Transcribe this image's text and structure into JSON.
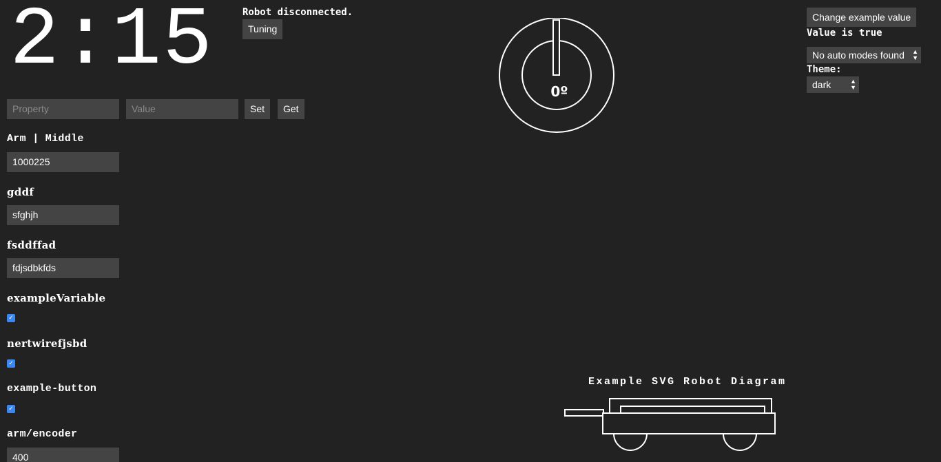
{
  "timer": {
    "value": "2:15"
  },
  "status": {
    "text": "Robot disconnected.",
    "tuning_label": "Tuning"
  },
  "tuning": {
    "property_placeholder": "Property",
    "value_placeholder": "Value",
    "set_label": "Set",
    "get_label": "Get"
  },
  "variables": [
    {
      "label": "Arm | Middle",
      "type": "text",
      "value": "1000225"
    },
    {
      "label": "gddf",
      "type": "text",
      "value": "sfghjh"
    },
    {
      "label": "fsddffad",
      "type": "text",
      "value": "fdjsdbkfds"
    },
    {
      "label": "exampleVariable",
      "type": "checkbox",
      "checked": true
    },
    {
      "label": "nertwirefjsbd",
      "type": "checkbox",
      "checked": true
    },
    {
      "label": "example-button",
      "type": "checkbox",
      "checked": true
    },
    {
      "label": "arm/encoder",
      "type": "text",
      "value": "400"
    }
  ],
  "gyro": {
    "value": "0º",
    "angle_deg": 0
  },
  "controls": {
    "change_button": "Change example value",
    "value_text": "Value is true",
    "auto_select": "No auto modes found",
    "theme_label": "Theme:",
    "theme_select": "dark"
  },
  "robot_diagram": {
    "title": "Example SVG Robot Diagram"
  },
  "colors": {
    "background": "#222222",
    "control": "#444444",
    "accent": "#3b86f0"
  }
}
